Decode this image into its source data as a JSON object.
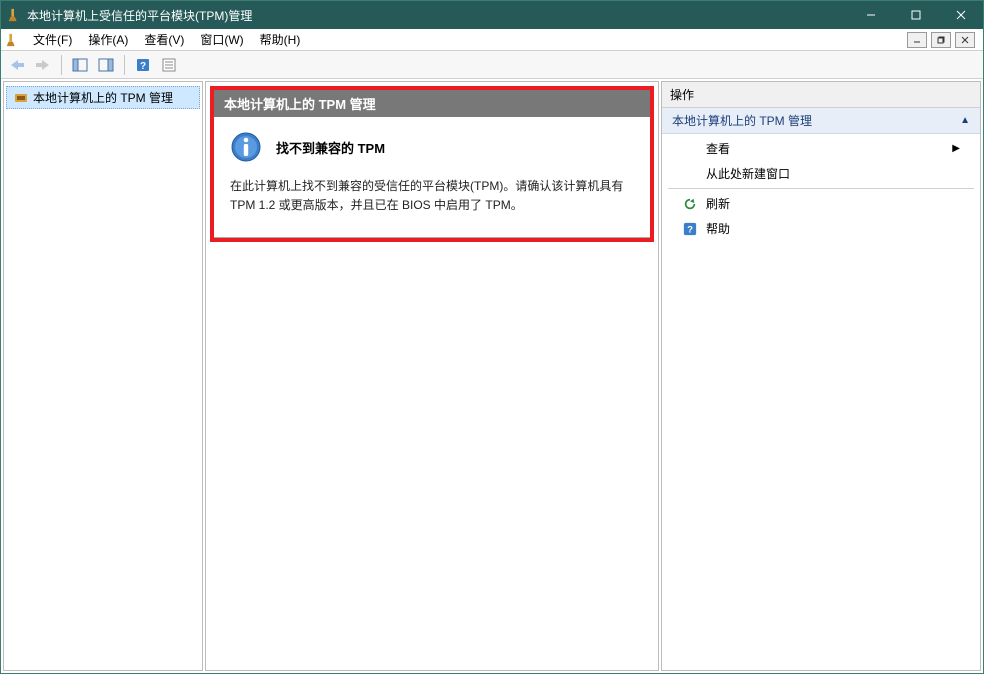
{
  "titlebar": {
    "title": "本地计算机上受信任的平台模块(TPM)管理"
  },
  "menubar": {
    "file": "文件(F)",
    "action": "操作(A)",
    "view": "查看(V)",
    "window": "窗口(W)",
    "help": "帮助(H)"
  },
  "tree": {
    "root": "本地计算机上的 TPM 管理"
  },
  "center": {
    "header": "本地计算机上的 TPM 管理",
    "msg_title": "找不到兼容的 TPM",
    "msg_body": "在此计算机上找不到兼容的受信任的平台模块(TPM)。请确认该计算机具有 TPM 1.2 或更高版本，并且已在 BIOS 中启用了 TPM。"
  },
  "actions": {
    "pane_title": "操作",
    "group_title": "本地计算机上的 TPM 管理",
    "view": "查看",
    "new_window": "从此处新建窗口",
    "refresh": "刷新",
    "help": "帮助"
  }
}
